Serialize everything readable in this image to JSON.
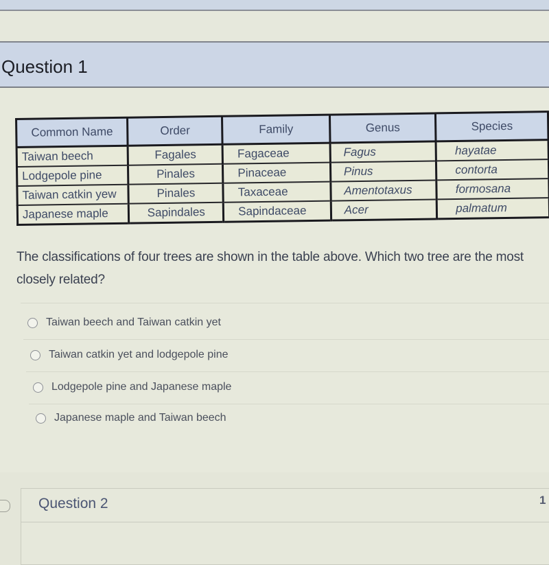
{
  "question1": {
    "title": "Question 1",
    "table": {
      "headers": [
        "Common Name",
        "Order",
        "Family",
        "Genus",
        "Species"
      ],
      "rows": [
        [
          "Taiwan beech",
          "Fagales",
          "Fagaceae",
          "Fagus",
          "hayatae"
        ],
        [
          "Lodgepole pine",
          "Pinales",
          "Pinaceae",
          "Pinus",
          "contorta"
        ],
        [
          "Taiwan catkin yew",
          "Pinales",
          "Taxaceae",
          "Amentotaxus",
          "formosana"
        ],
        [
          "Japanese maple",
          "Sapindales",
          "Sapindaceae",
          "Acer",
          "palmatum"
        ]
      ]
    },
    "prompt": "The classifications of four trees are shown in the table above.  Which two tree are the most closely related?",
    "options": [
      {
        "label": "Taiwan beech and Taiwan catkin yet",
        "selected": false
      },
      {
        "label": "Taiwan catkin yet and lodgepole pine",
        "selected": false
      },
      {
        "label": "Lodgepole pine and Japanese maple",
        "selected": false
      },
      {
        "label": "Japanese maple and Taiwan beech",
        "selected": false
      }
    ]
  },
  "question2": {
    "title": "Question 2",
    "points": "1"
  }
}
